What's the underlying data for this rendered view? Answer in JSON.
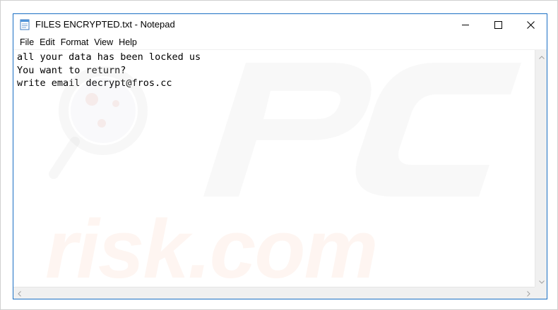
{
  "window": {
    "title": "FILES ENCRYPTED.txt - Notepad",
    "app_icon": "notepad-icon",
    "controls": {
      "minimize_icon": "minimize-icon",
      "maximize_icon": "maximize-icon",
      "close_icon": "close-icon"
    }
  },
  "menu": {
    "items": [
      {
        "label": "File"
      },
      {
        "label": "Edit"
      },
      {
        "label": "Format"
      },
      {
        "label": "View"
      },
      {
        "label": "Help"
      }
    ]
  },
  "editor": {
    "lines": [
      "all your data has been locked us",
      "You want to return?",
      "write email decrypt@fros.cc"
    ]
  },
  "watermark": {
    "text": "risk.com",
    "logo": "pcrisk-logo"
  },
  "colors": {
    "window_border": "#1a6fc4",
    "watermark": "#f0783c"
  }
}
